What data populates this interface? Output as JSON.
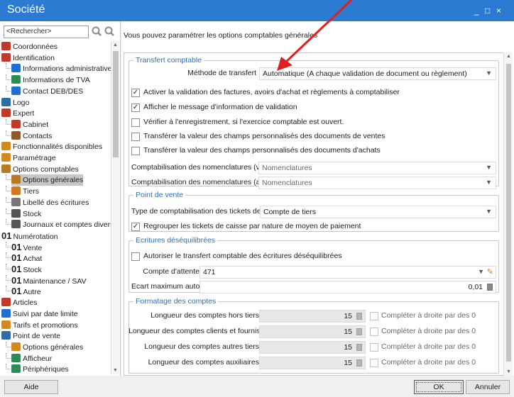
{
  "window": {
    "title": "Société",
    "controls": [
      "_",
      "□",
      "×"
    ]
  },
  "sidebar": {
    "search_placeholder": "<Rechercher>",
    "items": [
      {
        "label": "Coordonnées",
        "icon": "house-icon",
        "color": "#c0392b"
      },
      {
        "label": "Identification",
        "icon": "house-icon",
        "color": "#c0392b"
      },
      {
        "label": "Informations administratives",
        "icon": "info-icon",
        "color": "#1f6fd0"
      },
      {
        "label": "Informations de TVA",
        "icon": "percent-icon",
        "color": "#2e8b57"
      },
      {
        "label": "Contact DEB/DES",
        "icon": "truck-icon",
        "color": "#1f6fd0"
      },
      {
        "label": "Logo",
        "icon": "image-icon",
        "color": "#2e6da4"
      },
      {
        "label": "Expert",
        "icon": "house-icon",
        "color": "#c0392b"
      },
      {
        "label": "Cabinet",
        "icon": "house-icon",
        "color": "#c0392b"
      },
      {
        "label": "Contacts",
        "icon": "contacts-icon",
        "color": "#8e5a2b"
      },
      {
        "label": "Fonctionnalités disponibles",
        "icon": "modules-icon",
        "color": "#d08a1f"
      },
      {
        "label": "Paramétrage",
        "icon": "gears-icon",
        "color": "#d08a1f"
      },
      {
        "label": "Options comptables",
        "icon": "ledger-icon",
        "color": "#b77a24"
      },
      {
        "label": "Options générales",
        "icon": "ledger-icon",
        "color": "#b77a24"
      },
      {
        "label": "Tiers",
        "icon": "person-icon",
        "color": "#d07a1f"
      },
      {
        "label": "Libellé des écritures",
        "icon": "document-icon",
        "color": "#777777"
      },
      {
        "label": "Stock",
        "icon": "stock-icon",
        "color": "#555555"
      },
      {
        "label": "Journaux et comptes divers",
        "icon": "journal-icon",
        "color": "#555555"
      },
      {
        "label": "Numérotation",
        "icon": "numbering-icon",
        "prefix": "01"
      },
      {
        "label": "Vente",
        "icon": "numbering-icon",
        "prefix": "01"
      },
      {
        "label": "Achat",
        "icon": "numbering-icon",
        "prefix": "01"
      },
      {
        "label": "Stock",
        "icon": "numbering-icon",
        "prefix": "01"
      },
      {
        "label": "Maintenance / SAV",
        "icon": "numbering-icon",
        "prefix": "01"
      },
      {
        "label": "Autre",
        "icon": "numbering-icon",
        "prefix": "01"
      },
      {
        "label": "Articles",
        "icon": "articles-icon",
        "color": "#c0392b"
      },
      {
        "label": "Suivi par date limite",
        "icon": "calendar-icon",
        "color": "#1f6fd0"
      },
      {
        "label": "Tarifs et promotions",
        "icon": "tag-icon",
        "color": "#d08a1f"
      },
      {
        "label": "Point de vente",
        "icon": "register-icon",
        "color": "#2e6da4"
      },
      {
        "label": "Options générales",
        "icon": "gears-icon",
        "color": "#d08a1f"
      },
      {
        "label": "Afficheur",
        "icon": "display-icon",
        "color": "#2e8b57"
      },
      {
        "label": "Périphériques",
        "icon": "peripheral-icon",
        "color": "#2e8b57"
      }
    ],
    "selected_index": 12
  },
  "main": {
    "intro": "Vous pouvez paramétrer les options comptables générales",
    "transfert": {
      "legend": "Transfert comptable",
      "methode_label": "Méthode de transfert",
      "methode_value": "Automatique (A chaque validation de document ou règlement)",
      "checks": [
        {
          "label": "Activer la validation des factures, avoirs d'achat et règlements à comptabiliser",
          "checked": true
        },
        {
          "label": "Afficher le message d'information de validation",
          "checked": true
        },
        {
          "label": "Vérifier à l'enregistrement, si l'exercice comptable est ouvert.",
          "checked": false
        },
        {
          "label": "Transférer la valeur des champs personnalisés des documents de ventes",
          "checked": false
        },
        {
          "label": "Transférer la valeur des champs personnalisés des documents d'achats",
          "checked": false
        }
      ],
      "nomen_ventes_label": "Comptabilisation des nomenclatures (ventes)",
      "nomen_ventes_value": "Nomenclatures",
      "nomen_achats_label": "Comptabilisation des nomenclatures (achats)",
      "nomen_achats_value": "Nomenclatures"
    },
    "pdv": {
      "legend": "Point de vente",
      "type_label": "Type de comptabilisation des tickets de caisse",
      "type_value": "Compte de tiers",
      "regroup_label": "Regrouper les tickets de caisse par nature de moyen de paiement",
      "regroup_checked": true
    },
    "ecritures": {
      "legend": "Ecritures déséquilibrées",
      "autoriser_label": "Autoriser le transfert comptable des écritures déséquilibrées",
      "autoriser_checked": false,
      "attente_label": "Compte d'attente",
      "attente_value": "471",
      "ecart_label": "Ecart maximum autorisé",
      "ecart_value": "0,01"
    },
    "formatage": {
      "legend": "Formatage des comptes",
      "rows": [
        {
          "label": "Longueur des comptes hors tiers",
          "value": "15",
          "check_label": "Compléter à droite par des 0"
        },
        {
          "label": "Longueur des comptes clients et fournisseurs",
          "value": "15",
          "check_label": "Compléter à droite par des 0"
        },
        {
          "label": "Longueur des comptes autres tiers",
          "value": "15",
          "check_label": "Compléter à droite par des 0"
        },
        {
          "label": "Longueur des comptes auxiliaires",
          "value": "15",
          "check_label": "Compléter à droite par des 0"
        }
      ]
    }
  },
  "footer": {
    "help": "Aide",
    "ok": "OK",
    "cancel": "Annuler"
  },
  "colors": {
    "titlebar": "#2b7bd3",
    "legend": "#2d6fb8",
    "annotation_arrow": "#e02020"
  }
}
